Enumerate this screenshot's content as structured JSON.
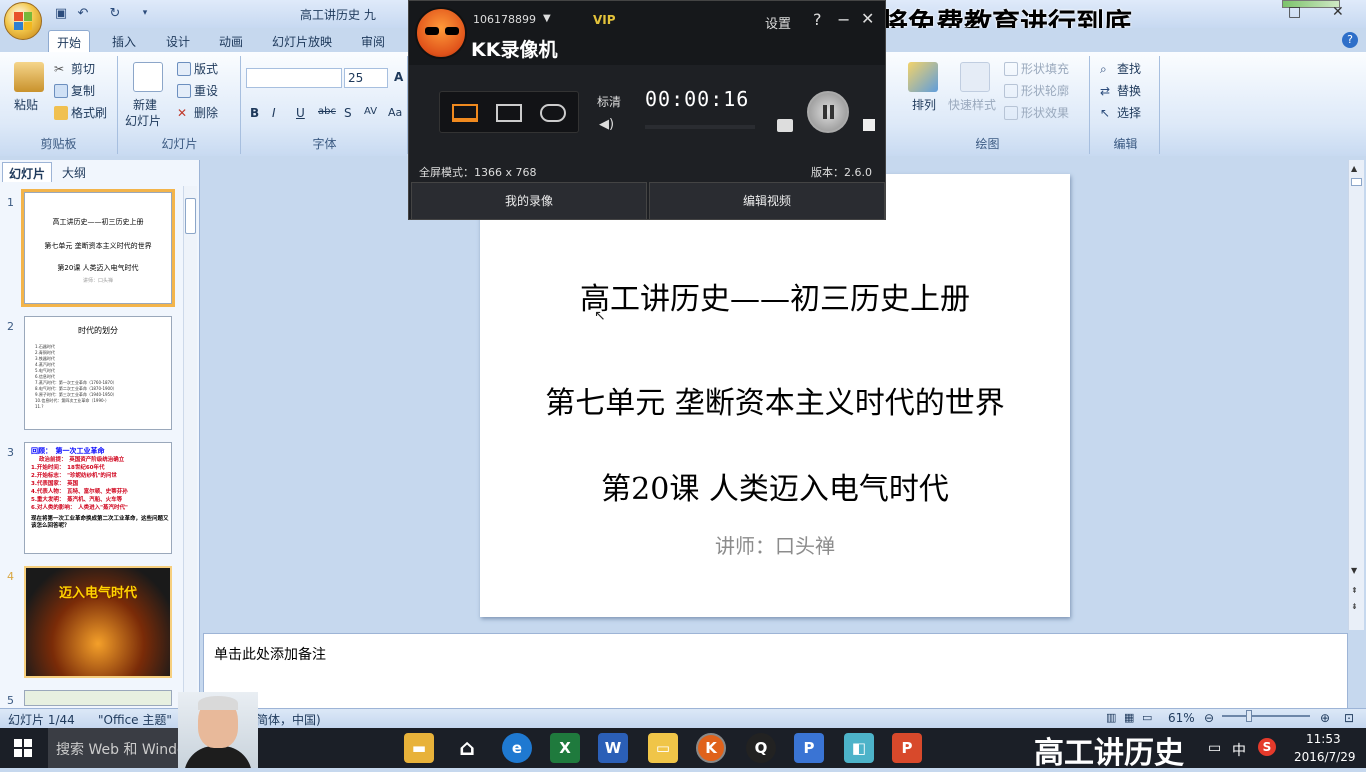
{
  "window": {
    "title": "高工讲历史 九",
    "promo_text": "将免费教育进行到底",
    "controls": {
      "minimize": "−",
      "maximize": "□",
      "close": "✕"
    }
  },
  "tabs": [
    "开始",
    "插入",
    "设计",
    "动画",
    "幻灯片放映",
    "审阅"
  ],
  "ribbon": {
    "clipboard": {
      "paste": "粘贴",
      "cut": "剪切",
      "copy": "复制",
      "format_painter": "格式刷",
      "label": "剪贴板"
    },
    "slides": {
      "new_slide": "新建",
      "new_slide2": "幻灯片",
      "layout": "版式",
      "reset": "重设",
      "delete": "删除",
      "label": "幻灯片"
    },
    "font": {
      "font_size": "25",
      "bold": "B",
      "italic": "I",
      "underline": "U",
      "strike": "abc",
      "shadow": "S",
      "spacing": "AV",
      "case": "Aa",
      "grow": "A",
      "label": "字体"
    },
    "drawing": {
      "arrange": "排列",
      "quick_styles": "快速样式",
      "fill": "形状填充",
      "outline": "形状轮廓",
      "effects": "形状效果",
      "label": "绘图"
    },
    "editing": {
      "find": "查找",
      "replace": "替换",
      "select": "选择",
      "label": "编辑"
    }
  },
  "left_pane": {
    "tab_slides": "幻灯片",
    "tab_outline": "大纲",
    "close": "✕",
    "thumbnails": [
      {
        "num": "1",
        "lines": [
          "高工讲历史——初三历史上册",
          "第七单元 垄断资本主义时代的世界",
          "第20课 人类迈入电气时代",
          "讲师：口头禅"
        ]
      },
      {
        "num": "2",
        "title": "时代的划分",
        "items": [
          "1.石器时代",
          "2.青铜时代",
          "3.铁器时代",
          "4.蒸汽时代",
          "5.电气时代",
          "6.信息时代",
          "7.蒸汽时代：第一次工业革命（1760-1870）",
          "8.电气时代：第二次工业革命（1870-1900）",
          "9.原子时代：第三次工业革命（1940-1950）",
          "10.信息时代：第四次工业革命（1990-）",
          "11.?"
        ]
      },
      {
        "num": "3",
        "title": "回顾：　第一次工业革命",
        "items": [
          "政治前提：　英国资产阶级统治确立",
          "1.开始时间：　18世纪60年代",
          "2.开始标志：　\"珍妮纺纱机\"的问世",
          "3.代表国家：　英国",
          "4.代表人物：　瓦特、富尔顿、史蒂芬孙",
          "5.重大发明：　蒸汽机、汽船、火车等",
          "6.对人类的影响：　人类进入\"蒸汽时代\""
        ],
        "footer": "现在将第一次工业革命换成第二次工业革命，这些问题又该怎么回答呢？"
      },
      {
        "num": "4",
        "title": "迈入电气时代"
      },
      {
        "num": "5"
      }
    ]
  },
  "slide": {
    "title": "高工讲历史——初三历史上册",
    "unit": "第七单元  垄断资本主义时代的世界",
    "lesson": "第20课 人类迈入电气时代",
    "lecturer": "讲师：口头禅"
  },
  "notes_placeholder": "单击此处添加备注",
  "status": {
    "slide_count": "幻灯片 1/44",
    "theme": "\"Office 主题\"",
    "language": "简体，中国)",
    "zoom": "61%"
  },
  "taskbar": {
    "search": "搜索 Web 和 Windows",
    "watermark": "高工讲历史",
    "ime": "中",
    "time": "11:53",
    "date": "2016/7/29"
  },
  "recorder": {
    "user_id": "106178899",
    "vip": "VIP",
    "name": "KK录像机",
    "settings": "设置",
    "help": "?",
    "quality": "标清",
    "timer": "00:00:16",
    "fullscreen": "全屏模式：1366 x 768",
    "version": "版本：2.6.0",
    "my_recordings": "我的录像",
    "edit_video": "编辑视频"
  },
  "colors": {
    "ribbon_bg": "#dde9f8",
    "accent": "#f3b44a",
    "recorder_bg": "#1e2024",
    "taskbar_bg": "#1b1f27"
  }
}
